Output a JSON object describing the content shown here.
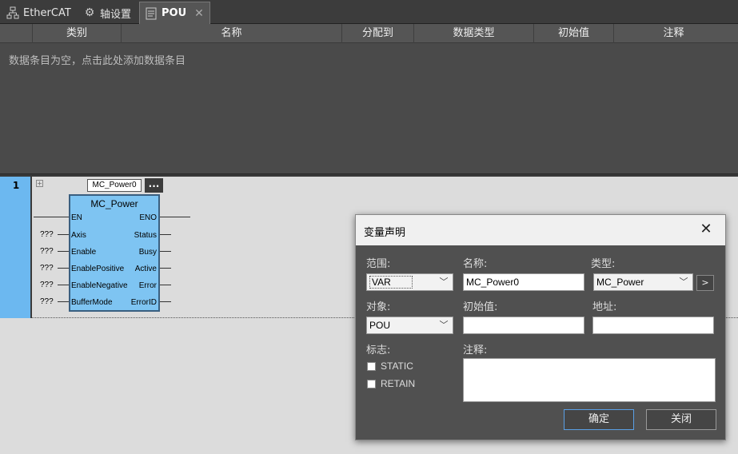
{
  "tabs": [
    {
      "label": "EtherCAT",
      "icon": "network-icon"
    },
    {
      "label": "轴设置",
      "icon": "gear-icon"
    },
    {
      "label": "POU",
      "icon": "document-icon",
      "active": true
    }
  ],
  "var_table": {
    "columns": [
      "类别",
      "名称",
      "分配到",
      "数据类型",
      "初始值",
      "注释"
    ],
    "empty_message": "数据条目为空，点击此处添加数据条目"
  },
  "ladder": {
    "rung_number": "1",
    "instance_name": "MC_Power0",
    "instance_button": "...",
    "fb": {
      "type": "MC_Power",
      "inputs": [
        "EN",
        "Axis",
        "Enable",
        "EnablePositive",
        "EnableNegative",
        "BufferMode"
      ],
      "outputs": [
        "ENO",
        "Status",
        "Busy",
        "Active",
        "Error",
        "ErrorID"
      ],
      "unassigned": "???"
    }
  },
  "dialog": {
    "title": "变量声明",
    "scope_label": "范围:",
    "scope_value": "VAR",
    "name_label": "名称:",
    "name_value": "MC_Power0",
    "type_label": "类型:",
    "type_value": "MC_Power",
    "type_button": ">",
    "object_label": "对象:",
    "object_value": "POU",
    "init_label": "初始值:",
    "init_value": "",
    "address_label": "地址:",
    "address_value": "",
    "flags_label": "标志:",
    "flag_static": "STATIC",
    "flag_retain": "RETAIN",
    "comment_label": "注释:",
    "comment_value": "",
    "ok_label": "确定",
    "cancel_label": "关闭"
  }
}
